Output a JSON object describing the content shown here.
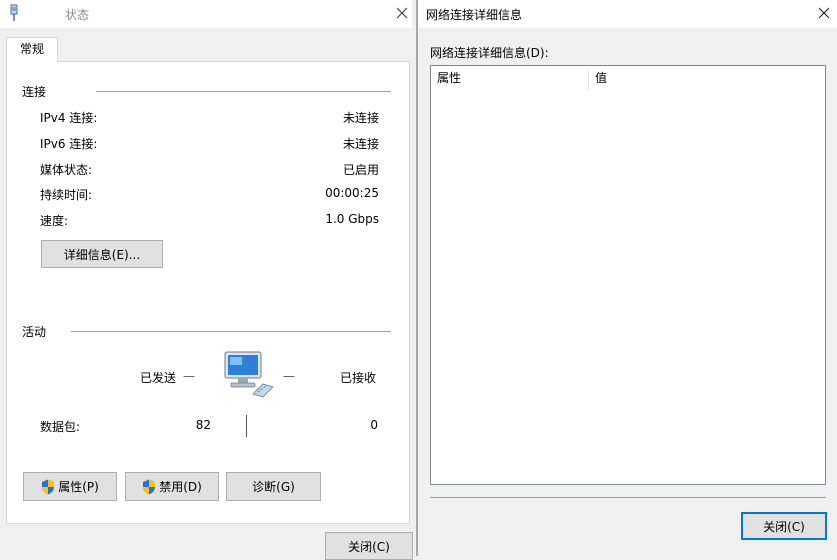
{
  "status_window": {
    "title": "状态",
    "tab": "常规",
    "connection": {
      "group_title": "连接",
      "rows": [
        {
          "label": "IPv4 连接:",
          "value": "未连接"
        },
        {
          "label": "IPv6 连接:",
          "value": "未连接"
        },
        {
          "label": "媒体状态:",
          "value": "已启用"
        },
        {
          "label": "持续时间:",
          "value": "00:00:25"
        },
        {
          "label": "速度:",
          "value": "1.0 Gbps"
        }
      ],
      "details_button": "详细信息(E)..."
    },
    "activity": {
      "group_title": "活动",
      "sent_label": "已发送",
      "received_label": "已接收",
      "dash": "—",
      "packets_label": "数据包:",
      "packets_sent": "82",
      "packets_received": "0"
    },
    "buttons": {
      "properties": "属性(P)",
      "disable": "禁用(D)",
      "diagnose": "诊断(G)",
      "close": "关闭(C)"
    }
  },
  "details_window": {
    "title": "网络连接详细信息",
    "list_label": "网络连接详细信息(D):",
    "columns": [
      "属性",
      "值"
    ],
    "close_button": "关闭(C)"
  },
  "colors": {
    "button_bg": "#e1e1e1",
    "focus_border": "#0078d7",
    "window_bg": "#f0f0f0",
    "shield_blue": "#2b6fd6",
    "shield_yellow": "#f5c518"
  },
  "icons": {
    "status_title": "network-adapter-icon",
    "network_activity": "network-computer-icon",
    "shield": "uac-shield-icon"
  }
}
